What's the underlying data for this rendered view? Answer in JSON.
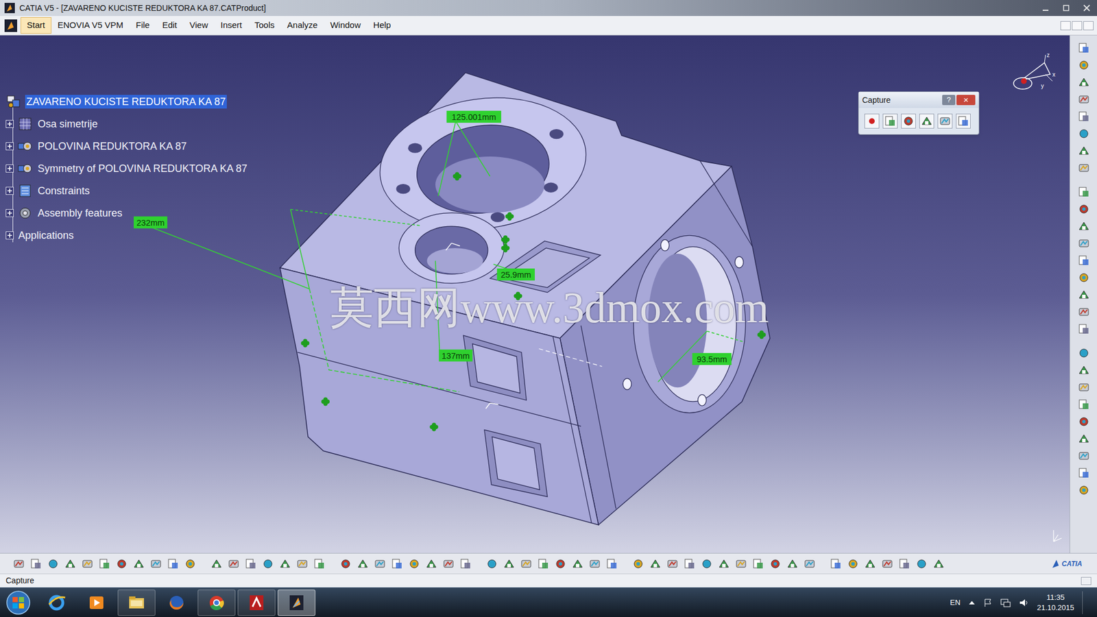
{
  "window": {
    "title": "CATIA V5 - [ZAVARENO KUCISTE REDUKTORA KA 87.CATProduct]"
  },
  "menu": [
    {
      "label": "Start",
      "highlighted": true
    },
    {
      "label": "ENOVIA V5 VPM",
      "highlighted": false
    },
    {
      "label": "File",
      "highlighted": false
    },
    {
      "label": "Edit",
      "highlighted": false
    },
    {
      "label": "View",
      "highlighted": false
    },
    {
      "label": "Insert",
      "highlighted": false
    },
    {
      "label": "Tools",
      "highlighted": false
    },
    {
      "label": "Analyze",
      "highlighted": false
    },
    {
      "label": "Window",
      "highlighted": false
    },
    {
      "label": "Help",
      "highlighted": false
    }
  ],
  "tree": [
    {
      "label": "ZAVARENO KUCISTE REDUKTORA KA 87",
      "kind": "product",
      "selected": true,
      "expandable": false
    },
    {
      "label": "Osa simetrije",
      "kind": "part",
      "selected": false,
      "expandable": true
    },
    {
      "label": "POLOVINA REDUKTORA KA 87",
      "kind": "component",
      "selected": false,
      "expandable": true
    },
    {
      "label": "Symmetry of POLOVINA REDUKTORA KA 87",
      "kind": "component",
      "selected": false,
      "expandable": true
    },
    {
      "label": "Constraints",
      "kind": "constraints",
      "selected": false,
      "expandable": true
    },
    {
      "label": "Assembly features",
      "kind": "features",
      "selected": false,
      "expandable": true
    },
    {
      "label": "Applications",
      "kind": "applications",
      "selected": false,
      "expandable": true
    }
  ],
  "measurements": [
    {
      "label": "125.001mm"
    },
    {
      "label": "232mm"
    },
    {
      "label": "25.9mm"
    },
    {
      "label": "137mm"
    },
    {
      "label": "93.5mm"
    }
  ],
  "watermark": "莫西网www.3dmox.com",
  "compass": {
    "axes": [
      "z",
      "x",
      "y"
    ]
  },
  "capture_toolbar": {
    "title": "Capture",
    "help": "?",
    "close": "×"
  },
  "toolbar_logo": "CATIA",
  "status_bar": {
    "text": "Capture"
  },
  "taskbar": {
    "apps": [
      {
        "kind": "ie",
        "running": false,
        "active": false
      },
      {
        "kind": "media",
        "running": false,
        "active": false
      },
      {
        "kind": "explorer",
        "running": true,
        "active": false
      },
      {
        "kind": "firefox",
        "running": false,
        "active": false
      },
      {
        "kind": "chrome",
        "running": true,
        "active": false
      },
      {
        "kind": "acrobat",
        "running": true,
        "active": false
      },
      {
        "kind": "catia",
        "running": true,
        "active": true
      }
    ],
    "language": "EN",
    "time": "11:35",
    "date": "21.10.2015"
  }
}
